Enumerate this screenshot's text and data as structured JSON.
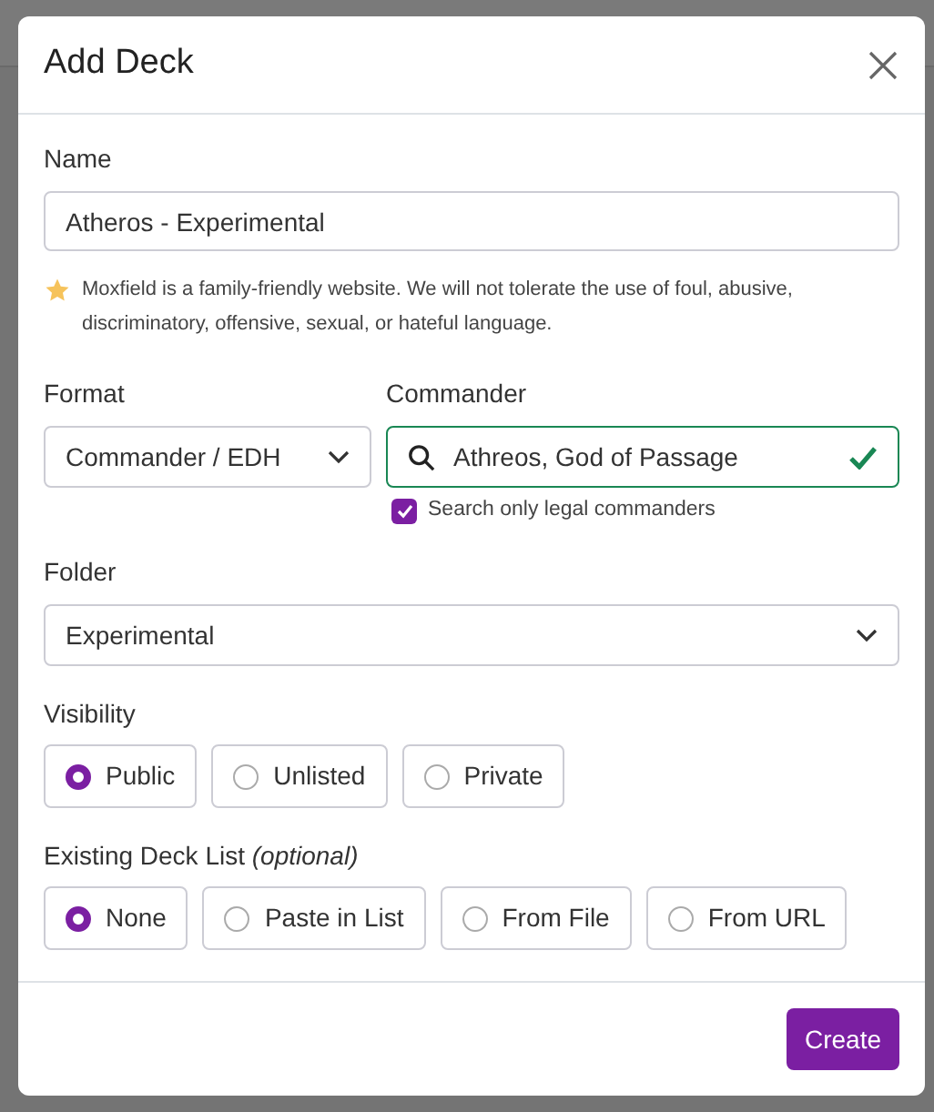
{
  "dialog": {
    "title": "Add Deck",
    "name": {
      "label": "Name",
      "value": "Atheros - Experimental"
    },
    "notice": "Moxfield is a family-friendly website. We will not tolerate the use of foul, abusive, discriminatory, offensive, sexual, or hateful language.",
    "format": {
      "label": "Format",
      "value": "Commander / EDH"
    },
    "commander": {
      "label": "Commander",
      "value": "Athreos, God of Passage",
      "valid": true,
      "legal_only": {
        "label": "Search only legal commanders",
        "checked": true
      }
    },
    "folder": {
      "label": "Folder",
      "value": "Experimental"
    },
    "visibility": {
      "label": "Visibility",
      "options": [
        {
          "label": "Public",
          "selected": true
        },
        {
          "label": "Unlisted",
          "selected": false
        },
        {
          "label": "Private",
          "selected": false
        }
      ]
    },
    "deck_list": {
      "label": "Existing Deck List",
      "hint": "(optional)",
      "options": [
        {
          "label": "None",
          "selected": true
        },
        {
          "label": "Paste in List",
          "selected": false
        },
        {
          "label": "From File",
          "selected": false
        },
        {
          "label": "From URL",
          "selected": false
        }
      ]
    },
    "create_button": "Create"
  }
}
